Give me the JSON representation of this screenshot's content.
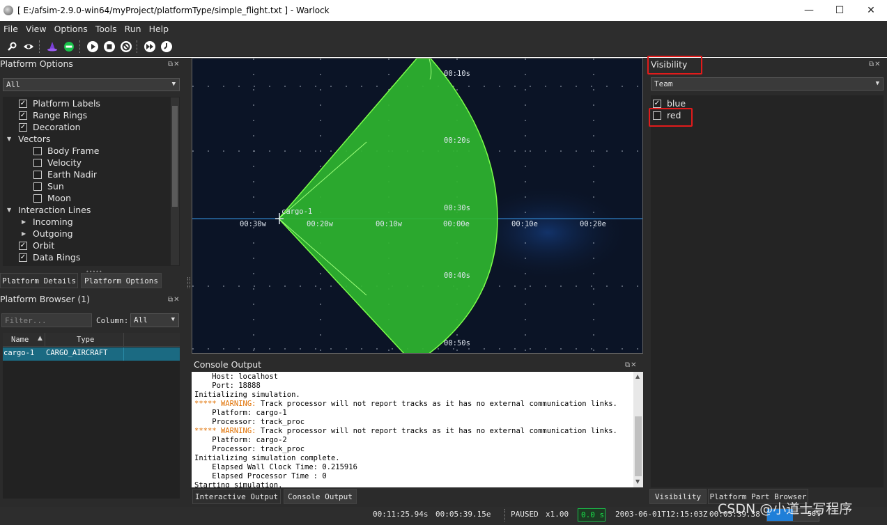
{
  "window": {
    "title": "[ E:/afsim-2.9.0-win64/myProject/platformType/simple_flight.txt ] - Warlock",
    "controls": {
      "minimize": "—",
      "maximize": "☐",
      "close": "✕"
    }
  },
  "menu": [
    "File",
    "View",
    "Options",
    "Tools",
    "Run",
    "Help"
  ],
  "toolbar": {
    "icons": [
      "search-icon",
      "eye-icon",
      "wizard-icon",
      "connect-icon",
      "play-icon",
      "stop-icon",
      "restart-icon",
      "fast-forward-icon",
      "clock-icon"
    ]
  },
  "platform_options": {
    "title": "Platform Options",
    "filter": "All",
    "items": [
      {
        "label": "Platform Labels",
        "checked": true,
        "kind": "check",
        "level": 0
      },
      {
        "label": "Range Rings",
        "checked": true,
        "kind": "check",
        "level": 0
      },
      {
        "label": "Decoration",
        "checked": true,
        "kind": "check",
        "level": 0
      },
      {
        "label": "Vectors",
        "kind": "expanded",
        "level": 0
      },
      {
        "label": "Body Frame",
        "checked": false,
        "kind": "check",
        "level": 1
      },
      {
        "label": "Velocity",
        "checked": false,
        "kind": "check",
        "level": 1
      },
      {
        "label": "Earth Nadir",
        "checked": false,
        "kind": "check",
        "level": 1
      },
      {
        "label": "Sun",
        "checked": false,
        "kind": "check",
        "level": 1
      },
      {
        "label": "Moon",
        "checked": false,
        "kind": "check",
        "level": 1
      },
      {
        "label": "Interaction Lines",
        "kind": "expanded",
        "level": 0
      },
      {
        "label": "Incoming",
        "kind": "collapsed",
        "level": 1
      },
      {
        "label": "Outgoing",
        "kind": "collapsed",
        "level": 1
      },
      {
        "label": "Orbit",
        "checked": true,
        "kind": "check",
        "level": 0
      },
      {
        "label": "Data Rings",
        "checked": true,
        "kind": "check",
        "level": 0
      }
    ],
    "tabs": [
      "Platform Details",
      "Platform Options"
    ]
  },
  "platform_browser": {
    "title": "Platform Browser (1)",
    "filter_placeholder": "Filter...",
    "column_label": "Column:",
    "column_value": "All",
    "headers": [
      "Name",
      "Type"
    ],
    "rows": [
      {
        "name": "cargo-1",
        "type": "CARGO_AIRCRAFT"
      }
    ]
  },
  "map": {
    "platform_label": "cargo-1",
    "lon_labels": [
      "00:30w",
      "00:20w",
      "00:10w",
      "00:00e",
      "00:10e",
      "00:20e"
    ],
    "lat_labels": [
      "00:10s",
      "00:20s",
      "00:30s",
      "00:40s",
      "00:50s"
    ],
    "colors": {
      "background": "#0b1426",
      "sector": "#2fb52f",
      "sector_edge": "#7cff4a",
      "equator": "#2f7fc4"
    }
  },
  "visibility": {
    "title": "Visibility",
    "filter": "Team",
    "teams": [
      {
        "label": "blue",
        "checked": true
      },
      {
        "label": "red",
        "checked": false
      }
    ],
    "tabs": [
      "Visibility",
      "Platform Part Browser"
    ]
  },
  "console": {
    "title": "Console Output",
    "lines": [
      {
        "text": "    Host: localhost"
      },
      {
        "text": "    Port: 18888"
      },
      {
        "text": "Initializing simulation."
      },
      {
        "prefix": "***** WARNING:",
        "text": " Track processor will not report tracks as it has no external communication links."
      },
      {
        "text": "    Platform: cargo-1"
      },
      {
        "text": "    Processor: track_proc"
      },
      {
        "prefix": "***** WARNING:",
        "text": " Track processor will not report tracks as it has no external communication links."
      },
      {
        "text": "    Platform: cargo-2"
      },
      {
        "text": "    Processor: track_proc"
      },
      {
        "text": "Initializing simulation complete."
      },
      {
        "text": "    Elapsed Wall Clock Time: 0.215916"
      },
      {
        "text": "    Elapsed Processor Time : 0"
      },
      {
        "text": "Starting simulation."
      }
    ],
    "tabs": [
      "Interactive Output",
      "Console Output"
    ]
  },
  "status": {
    "wall_time": "00:11:25.94s",
    "sim_time": "00:05:39.15e",
    "state": "PAUSED",
    "speed": "x1.00",
    "lag": "0.0 s",
    "datetime": "2003-06-01T12:15:03Z",
    "clock2": "00:05:39.38",
    "progress": "50%"
  },
  "watermark": "CSDN @小道士写程序"
}
